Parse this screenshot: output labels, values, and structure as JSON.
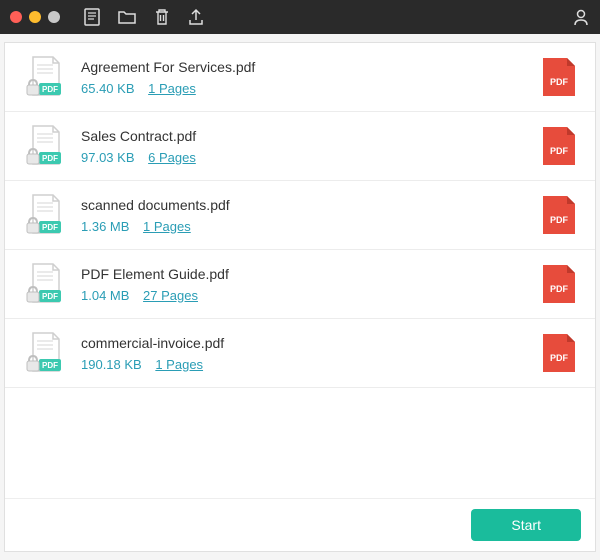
{
  "toolbar": {
    "icons": [
      "document-icon",
      "folder-icon",
      "trash-icon",
      "export-icon"
    ],
    "user_icon": "user-icon"
  },
  "files": [
    {
      "name": "Agreement For Services.pdf",
      "size": "65.40 KB",
      "pages": "1 Pages"
    },
    {
      "name": "Sales Contract.pdf",
      "size": "97.03 KB",
      "pages": "6 Pages"
    },
    {
      "name": "scanned documents.pdf",
      "size": "1.36 MB",
      "pages": "1 Pages"
    },
    {
      "name": "PDF Element Guide.pdf",
      "size": "1.04 MB",
      "pages": "27 Pages"
    },
    {
      "name": "commercial-invoice.pdf",
      "size": "190.18 KB",
      "pages": "1 Pages"
    }
  ],
  "badge_label": "PDF",
  "footer": {
    "start_label": "Start"
  },
  "colors": {
    "accent": "#1abc9c",
    "link": "#2a9db5",
    "pdf_red": "#e74c3c"
  }
}
